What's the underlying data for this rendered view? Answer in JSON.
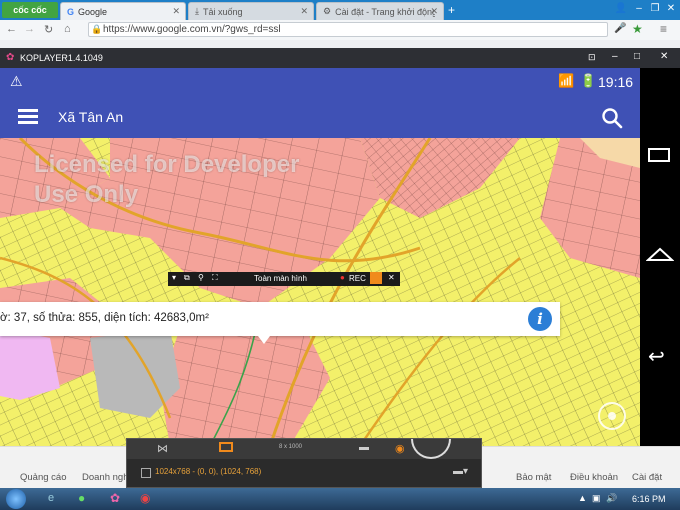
{
  "browser": {
    "brand": "cốc cốc",
    "tabs": [
      {
        "label": "Google"
      },
      {
        "label": "Tải xuống"
      },
      {
        "label": "Cài đặt - Trang khởi động"
      }
    ],
    "url": "https://www.google.com.vn/?gws_rd=ssl"
  },
  "emulator": {
    "title": "KOPLAYER1.4.1049",
    "status_time": "19:16",
    "app_title": "Xã Tân An",
    "watermark_line1": "Licensed for Developer",
    "watermark_line2": "Use Only",
    "rec_bar": {
      "fullscreen_label": "Toàn màn hình",
      "rec_label": "REC"
    },
    "info_text": "ờ: 37, số thửa: 855, diện tích: 42683,0m²",
    "info_icon": "i"
  },
  "capture_tool": {
    "resolution_text": "1024x768 - (0, 0), (1024, 768)",
    "small_label": "8 x 1000"
  },
  "google_footer": {
    "left_links": [
      "Quảng cáo",
      "Doanh nghi"
    ],
    "right_links": [
      "Bảo mật",
      "Điều khoản",
      "Cài đặt"
    ]
  },
  "taskbar": {
    "time": "6:16 PM"
  },
  "colors": {
    "app_bar": "#3f51b5",
    "browser_tabbar": "#1e7fc7",
    "parcel_pink": "#f4a39a",
    "parcel_yellow": "#f3f06a",
    "info_blue": "#2b7ed6"
  }
}
